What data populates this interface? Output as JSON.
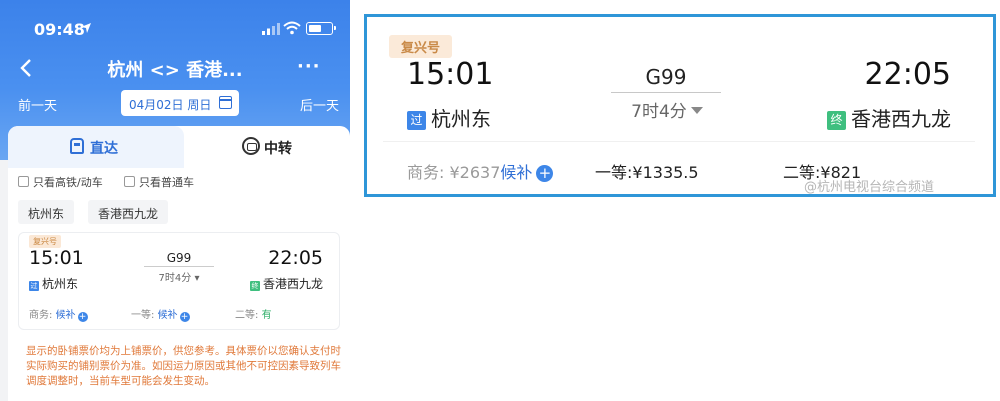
{
  "status_bar": {
    "time": "09:48"
  },
  "nav": {
    "title": "杭州 <> 香港...",
    "more": "···"
  },
  "date_bar": {
    "prev_day": "前一天",
    "date": "04月02日 周日",
    "next_day": "后一天"
  },
  "tabs": [
    {
      "label": "直达",
      "icon": "train-icon",
      "active": true
    },
    {
      "label": "中转",
      "icon": "transfer-icon",
      "active": false
    }
  ],
  "filters": [
    "只看高铁/动车",
    "只看普通车"
  ],
  "stations": [
    "杭州东",
    "香港西九龙"
  ],
  "train": {
    "type_badge": "复兴号",
    "number": "G99",
    "departure_time": "15:01",
    "arrival_time": "22:05",
    "duration": "7时4分",
    "departure_station": "杭州东",
    "arrival_station": "香港西九龙",
    "pass_tag": "过",
    "end_tag": "终"
  },
  "seats_app": {
    "business_label": "商务:",
    "business_value": "候补",
    "first_label": "一等:",
    "first_value": "候补",
    "second_label": "二等:",
    "second_value": "有"
  },
  "notice": "显示的卧铺票价均为上铺票价，供您参考。具体票价以您确认支付时实际购买的铺别票价为准。如因运力原因或其他不可控因素导致列车调度调整时，当前车型可能会发生变动。",
  "zoom": {
    "business_label": "商务:",
    "business_price": "¥2637",
    "business_status": "候补",
    "first_label": "一等:",
    "first_price": "¥1335.5",
    "second_label": "二等:",
    "second_price": "¥821",
    "watermark": "@杭州电视台综合频道"
  },
  "colors": {
    "accent": "#3d86e8",
    "frame": "#2f96d8",
    "notice": "#e0793a",
    "green": "#3fbf7f"
  }
}
